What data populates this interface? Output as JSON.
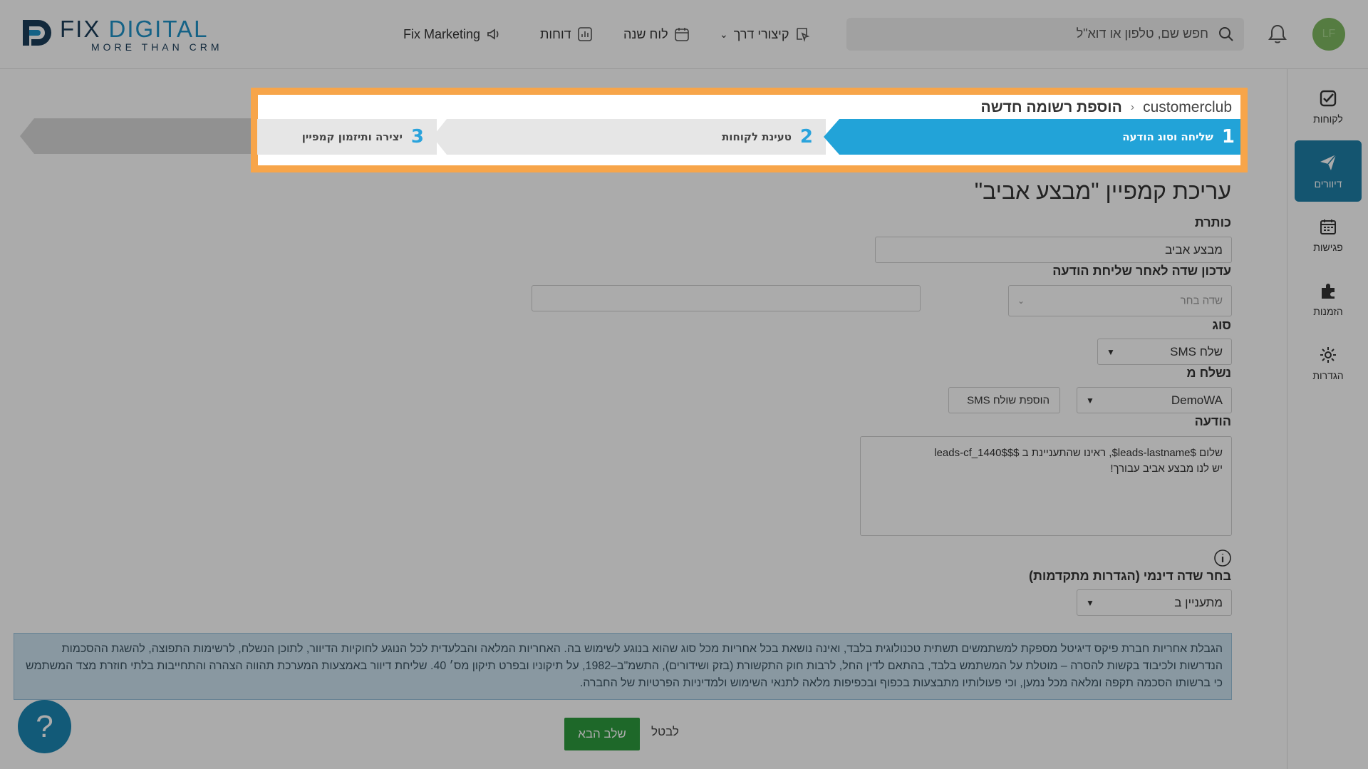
{
  "logo": {
    "main_prefix": "FIX ",
    "main_accent": "DIGITAL",
    "tagline": "MORE THAN CRM"
  },
  "nav": {
    "marketing": "Fix Marketing",
    "reports": "דוחות",
    "calendar": "לוח שנה",
    "shortcuts": "קיצורי דרך"
  },
  "search": {
    "placeholder": "חפש שם, טלפון או דוא\"ל"
  },
  "user": {
    "initials": "LF"
  },
  "sidebar": {
    "items": [
      {
        "label": "לקוחות",
        "icon": "checkbox-icon"
      },
      {
        "label": "דיוורים",
        "icon": "paper-plane-icon"
      },
      {
        "label": "פגישות",
        "icon": "calendar-icon"
      },
      {
        "label": "הזמנות",
        "icon": "puzzle-icon"
      },
      {
        "label": "הגדרות",
        "icon": "gear-icon"
      }
    ],
    "active": "דיוורים"
  },
  "breadcrumb": {
    "root": "customerclub",
    "current": "הוספת רשומה חדשה"
  },
  "steps": [
    {
      "num": "1",
      "label": "שליחה וסוג הודעה",
      "active": true
    },
    {
      "num": "2",
      "label": "טעינת לקוחות",
      "active": false
    },
    {
      "num": "3",
      "label": "יצירה ותיזמון קמפיין",
      "active": false
    }
  ],
  "form": {
    "title": "עריכת קמפיין \"מבצע אביב\"",
    "title_label": "כותרת",
    "title_value": "מבצע אביב",
    "update_field_label": "עדכון שדה לאחר שליחת הודעה",
    "update_field_placeholder": "שדה בחר",
    "update_field_value": "",
    "type_label": "סוג",
    "type_value": "שלח SMS",
    "sender_label": "נשלח מ",
    "sender_value": "DemoWA",
    "add_sender_button": "הוספת שולח SMS",
    "message_label": "הודעה",
    "message_value": "שלום $leads-lastname$, ראינו שהתעניינת ב $$leads-cf_1440$\nיש לנו מבצע אביב עבורך!",
    "dynamic_label": "בחר שדה דינמי (הגדרות מתקדמות)",
    "dynamic_value": "מתעניין ב"
  },
  "disclaimer": "הגבלת אחריות חברת פיקס דיגיטל מספקת למשתמשים תשתית טכנולוגית בלבד, ואינה נושאת בכל אחריות מכל סוג שהוא בנוגע לשימוש בה. האחריות המלאה והבלעדית לכל הנוגע לחוקיות הדיוור, לתוכן הנשלח, לרשימות התפוצה, להשגת ההסכמות הנדרשות ולכיבוד בקשות להסרה – מוטלת על המשתמש בלבד, בהתאם לדין החל, לרבות חוק התקשורת (בזק ושידורים), התשמ\"ב–1982, על תיקוניו ובפרט תיקון מס׳ 40. שליחת דיוור באמצעות המערכת תהווה הצהרה והתחייבות בלתי חוזרת מצד המשתמש כי ברשותו הסכמה תקפה ומלאה מכל נמען, וכי פעולותיו מתבצעות בכפוף ובכפיפות מלאה לתנאי השימוש ולמדיניות הפרטיות של החברה.",
  "buttons": {
    "next": "שלב הבא",
    "cancel": "לבטל",
    "help": "?"
  },
  "colors": {
    "accent": "#22a3d8",
    "highlight": "#f7a54a",
    "next": "#2e9b3e",
    "sidebar_active": "#1e7fa8"
  }
}
